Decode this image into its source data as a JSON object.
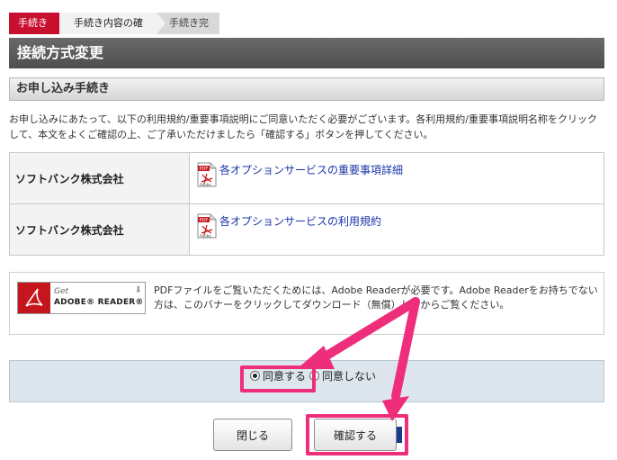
{
  "steps": [
    "手続き",
    "手続き内容の確認",
    "手続き完了"
  ],
  "title": "接続方式変更",
  "section_heading": "お申し込み手続き",
  "intro": "お申し込みにあたって、以下の利用規約/重要事項説明にご同意いただく必要がございます。各利用規約/重要事項説明名称をクリックして、本文をよくご確認の上、ご了承いただけましたら「確認する」ボタンを押してください。",
  "documents": [
    {
      "company": "ソフトバンク株式会社",
      "link": "各オプションサービスの重要事項詳細",
      "icon": "pdf-icon"
    },
    {
      "company": "ソフトバンク株式会社",
      "link": "各オプションサービスの利用規約",
      "icon": "pdf-icon"
    }
  ],
  "adobe": {
    "get": "Get",
    "name": "ADOBE® READER®",
    "text": "PDFファイルをご覧いただくためには、Adobe Readerが必要です。Adobe Readerをお持ちでない方は、このバナーをクリックしてダウンロード（無償）してからご覧ください。"
  },
  "agreement": {
    "agree_label": "同意する",
    "disagree_label": "同意しない",
    "selected": "agree"
  },
  "buttons": {
    "close_label": "閉じる",
    "confirm_label": "確認する"
  },
  "colors": {
    "step_active": "#c8102e",
    "title_bar": "#5a5a5a",
    "link": "#1a35a8",
    "highlight": "#ee2e7a",
    "agree_bg": "#dde6ed"
  }
}
